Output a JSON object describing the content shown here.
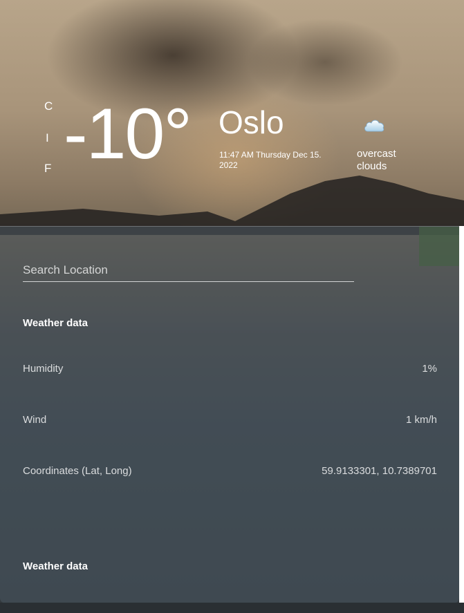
{
  "header": {
    "units": {
      "celsius": "C",
      "separator": "I",
      "fahrenheit": "F"
    },
    "temperature": "-10°",
    "city": "Oslo",
    "datetime": "11:47 AM Thursday Dec 15. 2022",
    "condition": "overcast clouds",
    "condition_icon": "cloud-icon"
  },
  "search": {
    "placeholder": "Search Location",
    "value": ""
  },
  "weather_section": {
    "title": "Weather data",
    "rows": [
      {
        "label": "Humidity",
        "value": "1%"
      },
      {
        "label": "Wind",
        "value": "1 km/h"
      },
      {
        "label": "Coordinates (Lat, Long)",
        "value": "59.9133301, 10.7389701"
      }
    ]
  },
  "second_section": {
    "title": "Weather data"
  },
  "colors": {
    "panel": "#485660",
    "text": "#ffffff"
  }
}
